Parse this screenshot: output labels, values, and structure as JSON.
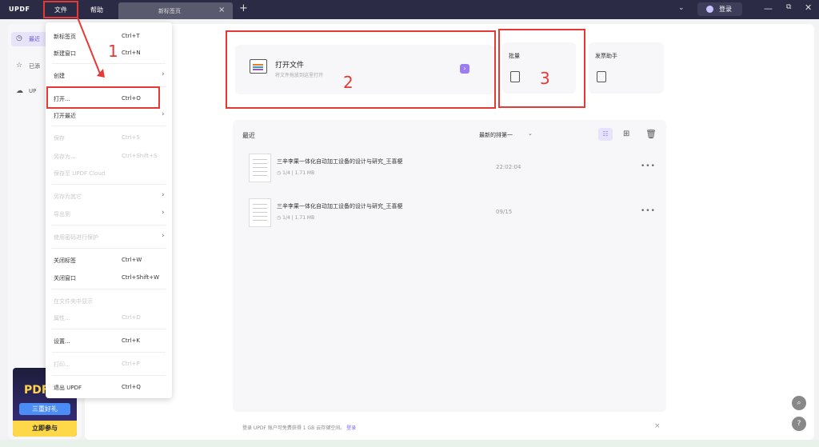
{
  "titlebar": {
    "logo": "UPDF",
    "menu_file": "文件",
    "menu_help": "帮助",
    "tab_label": "新标签页",
    "tab_close": "×",
    "tab_add": "+",
    "chevron": "⌄",
    "login_label": "登录",
    "win_min": "—",
    "win_max": "⧉",
    "win_close": "✕"
  },
  "sidebar": {
    "recent_label": "最近",
    "starred_label": "已添",
    "cloud_label": "UP",
    "promo_pdf": "PDF",
    "promo_tag": "三重好礼",
    "promo_join": "立即参与"
  },
  "file_menu": {
    "items": [
      {
        "label": "新标签页",
        "shortcut": "Ctrl+T"
      },
      {
        "label": "新建窗口",
        "shortcut": "Ctrl+N"
      },
      {
        "label": "创建",
        "shortcut": "",
        "arrow": "›"
      },
      {
        "label": "打开...",
        "shortcut": "Ctrl+O"
      },
      {
        "label": "打开最近",
        "shortcut": "",
        "arrow": "›"
      },
      {
        "label": "保存",
        "shortcut": "Ctrl+S"
      },
      {
        "label": "另存为...",
        "shortcut": "Ctrl+Shift+S"
      },
      {
        "label": "保存至 UPDF Cloud",
        "shortcut": ""
      },
      {
        "label": "另存为其它",
        "shortcut": "",
        "arrow": "›"
      },
      {
        "label": "导出到",
        "shortcut": "",
        "arrow": "›"
      },
      {
        "label": "使用密码进行保护",
        "shortcut": "",
        "arrow": "›"
      },
      {
        "label": "关闭标签",
        "shortcut": "Ctrl+W"
      },
      {
        "label": "关闭窗口",
        "shortcut": "Ctrl+Shift+W"
      },
      {
        "label": "在文件夹中显示",
        "shortcut": ""
      },
      {
        "label": "属性...",
        "shortcut": "Ctrl+D"
      },
      {
        "label": "设置...",
        "shortcut": "Ctrl+K"
      },
      {
        "label": "打印...",
        "shortcut": "Ctrl+P"
      },
      {
        "label": "退出 UPDF",
        "shortcut": "Ctrl+Q"
      }
    ]
  },
  "main": {
    "open_title": "打开文件",
    "open_sub": "将文件拖放到这里打开",
    "open_arrow": "›",
    "batch_label": "批量",
    "assist_label": "发票助手",
    "recent_title": "最近",
    "sort_label": "最新的排第一",
    "sort_caret": "⌄",
    "view_list_icon": "☷",
    "view_grid_icon": "⊞",
    "trash_icon": "🗑",
    "files": [
      {
        "name": "三辛李果一体化自动加工设备的设计与研究_王喜梗",
        "pages": "1/4",
        "size": "1.71 MB",
        "time": "22:02:04",
        "more": "•••"
      },
      {
        "name": "三辛李果一体化自动加工设备的设计与研究_王喜梗",
        "pages": "1/4",
        "size": "1.71 MB",
        "time": "09/15",
        "more": "•••"
      }
    ],
    "banner_text": "登录 UPDF 账户可免费获得 1 GB 云存储空间。",
    "banner_link": "登录",
    "banner_close": "×"
  },
  "floating": {
    "search": "⌕",
    "help": "?"
  },
  "annotations": {
    "n1": "1",
    "n2": "2",
    "n3": "3"
  }
}
